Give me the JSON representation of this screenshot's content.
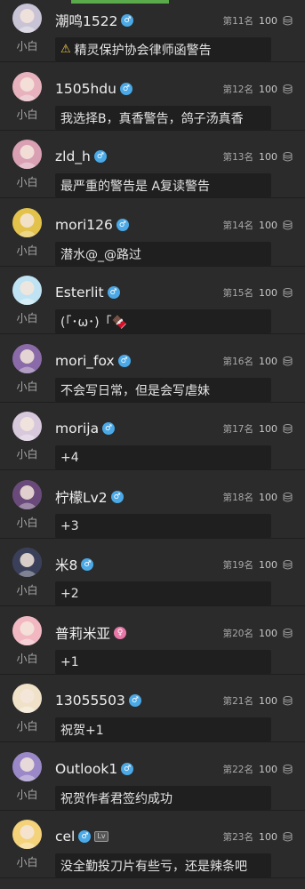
{
  "accent_color": "#5aa94a",
  "rows": [
    {
      "username": "潮鸣1522",
      "gender": "male",
      "tag": "小白",
      "rank": "第11名",
      "score": "100",
      "comment": "精灵保护协会律师函警告",
      "warn": true,
      "avatar_color": "#c9c3d6"
    },
    {
      "username": "1505hdu",
      "gender": "male",
      "tag": "小白",
      "rank": "第12名",
      "score": "100",
      "comment": "我选择B，真香警告，鸽子汤真香",
      "avatar_color": "#e7b2bd"
    },
    {
      "username": "zld_h",
      "gender": "male",
      "tag": "小白",
      "rank": "第13名",
      "score": "100",
      "comment": "最严重的警告是  A复读警告",
      "avatar_color": "#d99fb3"
    },
    {
      "username": "mori126",
      "gender": "male",
      "tag": "小白",
      "rank": "第14名",
      "score": "100",
      "comment": "潜水@_@路过",
      "avatar_color": "#e2c24a"
    },
    {
      "username": "Esterlit",
      "gender": "male",
      "tag": "小白",
      "rank": "第15名",
      "score": "100",
      "comment": "(「･ω･)「🍫",
      "avatar_color": "#bfe3f2"
    },
    {
      "username": "mori_fox",
      "gender": "male",
      "tag": "小白",
      "rank": "第16名",
      "score": "100",
      "comment": "不会写日常，但是会写虐妹",
      "avatar_color": "#8a6aa8"
    },
    {
      "username": "morija",
      "gender": "male",
      "tag": "小白",
      "rank": "第17名",
      "score": "100",
      "comment": "+4",
      "avatar_color": "#d8c8dc"
    },
    {
      "username": "柠檬Lv2",
      "gender": "male",
      "tag": "小白",
      "rank": "第18名",
      "score": "100",
      "comment": "+3",
      "avatar_color": "#6a4a7a"
    },
    {
      "username": "米8",
      "gender": "male",
      "tag": "小白",
      "rank": "第19名",
      "score": "100",
      "comment": "+2",
      "avatar_color": "#3a3f5a"
    },
    {
      "username": "普莉米亚",
      "gender": "female",
      "tag": "小白",
      "rank": "第20名",
      "score": "100",
      "comment": "+1",
      "avatar_color": "#f2b8c2"
    },
    {
      "username": "13055503",
      "gender": "male",
      "tag": "小白",
      "rank": "第21名",
      "score": "100",
      "comment": "祝贺+1",
      "avatar_color": "#f0e2c8"
    },
    {
      "username": "Outlook1",
      "gender": "male",
      "tag": "小白",
      "rank": "第22名",
      "score": "100",
      "comment": "祝贺作者君签约成功",
      "avatar_color": "#9a88c8"
    },
    {
      "username": "cel",
      "gender": "male",
      "tag": "小白",
      "rank": "第23名",
      "score": "100",
      "comment": "没全勤投刀片有些亏，还是辣条吧",
      "lv_badge": "Lv",
      "avatar_color": "#f3d27a"
    }
  ]
}
